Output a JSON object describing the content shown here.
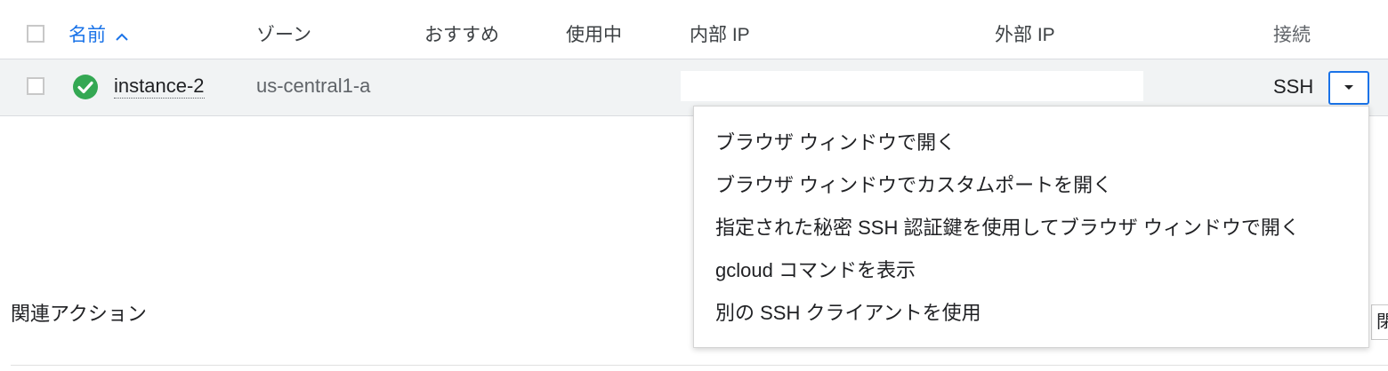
{
  "table": {
    "headers": {
      "name": "名前",
      "zone": "ゾーン",
      "recommendation": "おすすめ",
      "in_use": "使用中",
      "internal_ip": "内部 IP",
      "external_ip": "外部 IP",
      "connect": "接続"
    },
    "sort_icon": "chevron-up-icon",
    "rows": [
      {
        "status_icon": "check-circle-icon",
        "status_color": "#34a853",
        "name": "instance-2",
        "zone": "us-central1-a",
        "connect_label": "SSH"
      }
    ]
  },
  "ssh_menu": {
    "items": [
      "ブラウザ ウィンドウで開く",
      "ブラウザ ウィンドウでカスタムポートを開く",
      "指定された秘密 SSH 認証鍵を使用してブラウザ ウィンドウで開く",
      "gcloud コマンドを表示",
      "別の SSH クライアントを使用"
    ]
  },
  "related_actions": {
    "title": "関連アクション",
    "partial_button_text": "閉"
  },
  "colors": {
    "accent": "#1a73e8",
    "row_background": "#f1f3f4",
    "status_ok": "#34a853"
  }
}
